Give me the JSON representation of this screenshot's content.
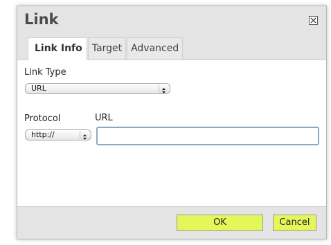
{
  "dialog": {
    "title": "Link",
    "close_icon": "close-box-icon"
  },
  "tabs": [
    {
      "label": "Link Info",
      "active": true
    },
    {
      "label": "Target",
      "active": false
    },
    {
      "label": "Advanced",
      "active": false
    }
  ],
  "link_type": {
    "label": "Link Type",
    "selected": "URL"
  },
  "protocol": {
    "label": "Protocol",
    "selected": "http://"
  },
  "url": {
    "label": "URL",
    "value": ""
  },
  "buttons": {
    "ok": "OK",
    "cancel": "Cancel"
  },
  "colors": {
    "button_accent": "#e3f75a",
    "header_bg": "#e4e4e4",
    "input_focus_border": "#8ea6c4"
  }
}
